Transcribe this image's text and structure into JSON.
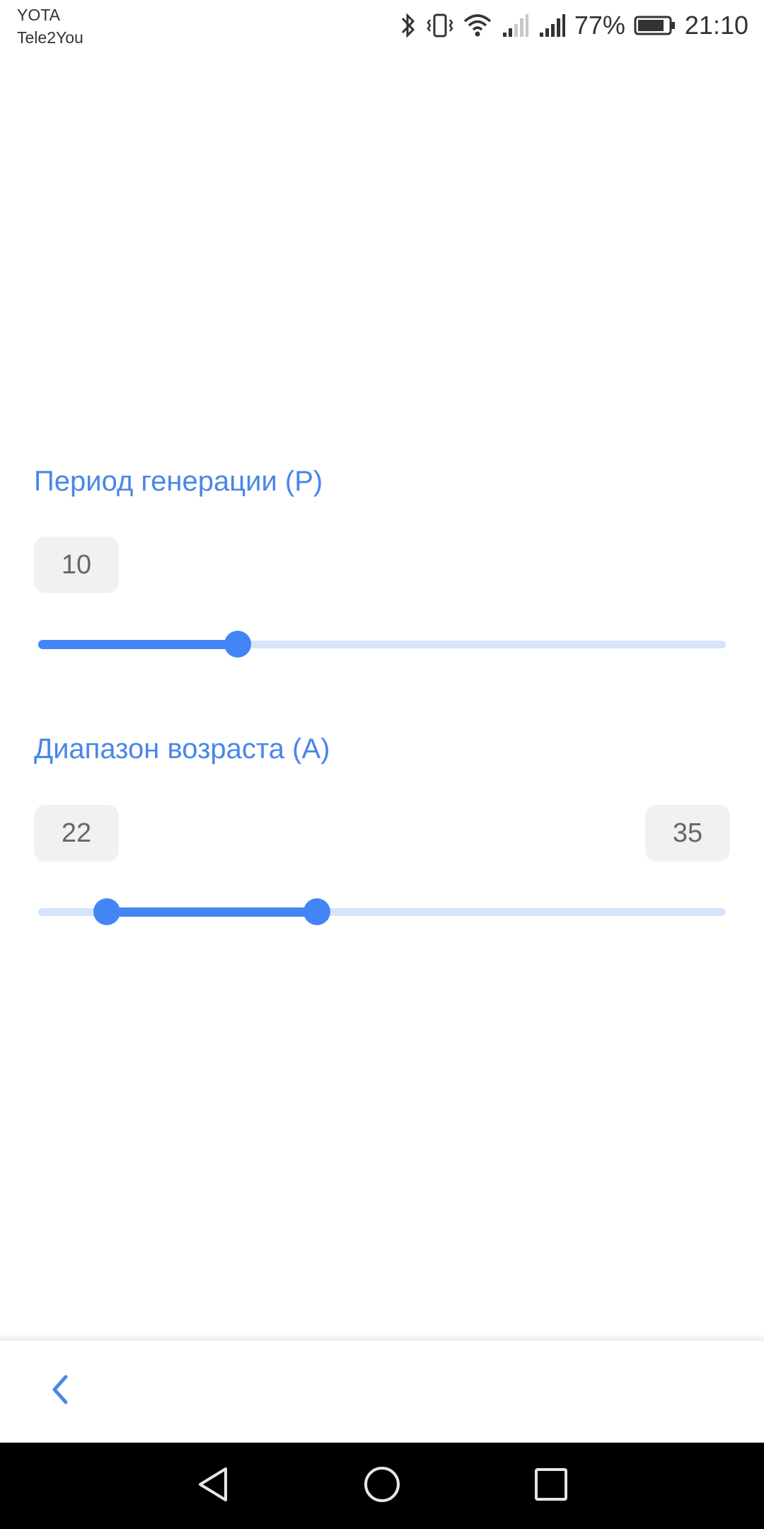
{
  "status_bar": {
    "carrier_1": "YOTA",
    "carrier_2": "Tele2You",
    "battery_percent": "77%",
    "time": "21:10",
    "icons": [
      "bluetooth-icon",
      "vibrate-icon",
      "wifi-icon",
      "signal-weak-icon",
      "signal-full-icon",
      "battery-icon"
    ]
  },
  "period": {
    "title": "Период генерации (P)",
    "value": "10",
    "slider_fraction": 0.29
  },
  "age_range": {
    "title": "Диапазон возраста (A)",
    "min_value": "22",
    "max_value": "35",
    "lower_fraction": 0.1,
    "upper_fraction": 0.405
  },
  "toolbar": {
    "back_icon": "chevron-left-icon"
  },
  "nav": {
    "icons": [
      "nav-back-icon",
      "nav-home-icon",
      "nav-recents-icon"
    ]
  },
  "colors": {
    "accent": "#4285f4",
    "title": "#4a86e8",
    "track_inactive": "#d6e4fa",
    "value_box_bg": "#f1f1f1"
  }
}
